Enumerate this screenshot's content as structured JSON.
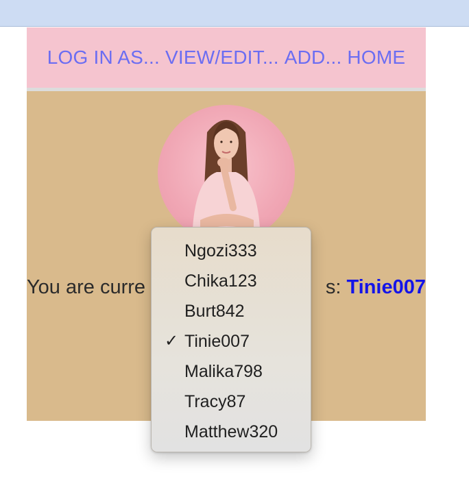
{
  "nav": {
    "items": [
      "LOG IN AS...",
      "VIEW/EDIT...",
      "ADD...",
      "HOME"
    ]
  },
  "status": {
    "prefix": "You are curre",
    "suffix": "s:",
    "current_user": "Tinie007"
  },
  "dropdown": {
    "options": [
      "Ngozi333",
      "Chika123",
      "Burt842",
      "Tinie007",
      "Malika798",
      "Tracy87",
      "Matthew320"
    ],
    "selected": "Tinie007",
    "check_glyph": "✓"
  },
  "colors": {
    "topbar": "#cddcf3",
    "nav_bg": "#f5c4cf",
    "nav_link": "#6b6df2",
    "content_bg": "#d9ba8c",
    "username": "#1414e8"
  }
}
